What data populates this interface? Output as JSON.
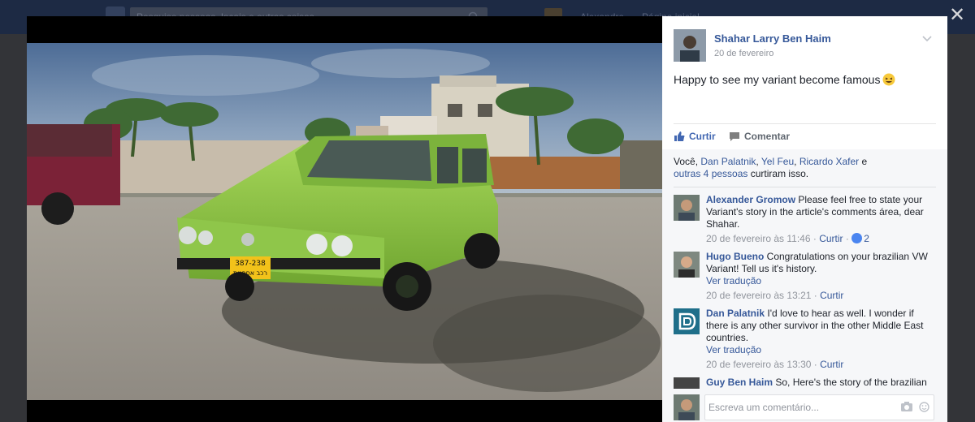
{
  "topbar": {
    "search_placeholder": "Pesquise pessoas, locais e outras coisas",
    "nav_items": [
      "Alexandre",
      "Página inicial"
    ]
  },
  "post": {
    "author": "Shahar Larry Ben Haim",
    "date": "20 de fevereiro",
    "text": "Happy to see my variant become famous",
    "actions": {
      "like": "Curtir",
      "comment": "Comentar"
    }
  },
  "likes": {
    "prefix": "Você,",
    "names": [
      "Dan Palatnik",
      "Yel Feu",
      "Ricardo Xafer"
    ],
    "and_word": "e",
    "others": "outras 4 pessoas",
    "suffix": "curtiram isso."
  },
  "comments": [
    {
      "author": "Alexander Gromow",
      "text": "Please feel free to state your Variant's story in the article's comments área, dear Shahar.",
      "time": "20 de fevereiro às 11:46",
      "reply": "Curtir",
      "reactions": "2",
      "translate": ""
    },
    {
      "author": "Hugo Bueno",
      "text": "Congratulations on your brazilian VW Variant! Tell us it's history.",
      "translate": "Ver tradução",
      "time": "20 de fevereiro às 13:21",
      "reply": "Curtir"
    },
    {
      "author": "Dan Palatnik",
      "text": "I'd love to hear as well. I wonder if there is any other survivor in the other Middle East countries.",
      "translate": "Ver tradução",
      "time": "20 de fevereiro às 13:30",
      "reply": "Curtir"
    },
    {
      "author": "Guy Ben Haim",
      "text": "So, Here's the story of the brazilian"
    }
  ],
  "compose": {
    "placeholder": "Escreva um comentário..."
  },
  "photo": {
    "plate_top": "387-238",
    "plate_bottom": "רכב אספנות"
  },
  "colors": {
    "link": "#365899",
    "like_active": "#4267b2",
    "car": "#8cc63e",
    "backdrop": "#333438"
  }
}
